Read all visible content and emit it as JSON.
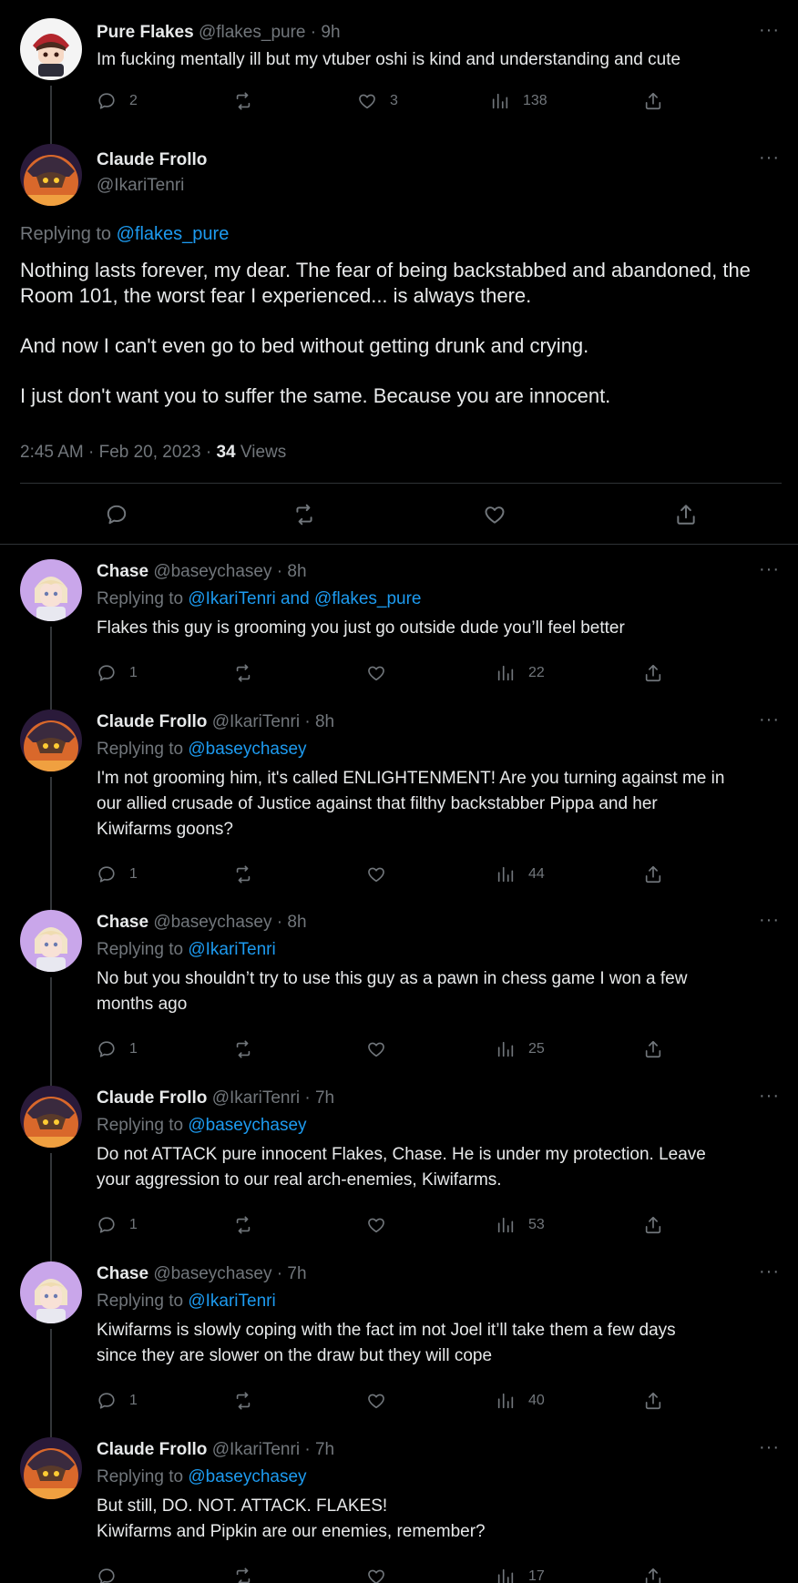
{
  "tweets": [
    {
      "name": "Pure Flakes",
      "handle": "@flakes_pure",
      "time": "9h",
      "text": "Im fucking mentally ill but my vtuber oshi is kind and understanding and cute",
      "replies": "2",
      "retweets": "",
      "likes": "3",
      "views": "138"
    }
  ],
  "focused": {
    "name": "Claude Frollo",
    "handle": "@IkariTenri",
    "replying_prefix": "Replying to ",
    "replying_to": "@flakes_pure",
    "paragraphs": [
      "Nothing lasts forever, my dear. The fear of being backstabbed and abandoned, the Room 101, the worst fear I experienced... is always there.",
      "And now I can't even go to bed without getting drunk and crying.",
      "I just don't want you to suffer the same. Because you are innocent."
    ],
    "timestamp": "2:45 AM · Feb 20, 2023 · ",
    "views_count": "34",
    "views_label": " Views"
  },
  "replies": [
    {
      "name": "Chase",
      "handle": "@baseychasey",
      "time": "8h",
      "replying_prefix": "Replying to ",
      "replying_to": "@IkariTenri and @flakes_pure",
      "lines": [
        "Flakes this guy is grooming you just go outside dude you’ll feel better"
      ],
      "replies": "1",
      "views": "22"
    },
    {
      "name": "Claude Frollo",
      "handle": "@IkariTenri",
      "time": "8h",
      "replying_prefix": "Replying to ",
      "replying_to": "@baseychasey",
      "lines": [
        "I'm not grooming him, it's called ENLIGHTENMENT! Are you turning against me in",
        "our allied crusade of Justice against that filthy backstabber Pippa and her",
        "Kiwifarms goons?"
      ],
      "replies": "1",
      "views": "44"
    },
    {
      "name": "Chase",
      "handle": "@baseychasey",
      "time": "8h",
      "replying_prefix": "Replying to ",
      "replying_to": "@IkariTenri",
      "lines": [
        "No but you shouldn’t try to use this guy as a pawn in chess game I won a few",
        "months ago"
      ],
      "replies": "1",
      "views": "25"
    },
    {
      "name": "Claude Frollo",
      "handle": "@IkariTenri",
      "time": "7h",
      "replying_prefix": "Replying to ",
      "replying_to": "@baseychasey",
      "lines": [
        "Do not ATTACK pure innocent Flakes, Chase. He is under my protection. Leave",
        "your aggression to our real arch-enemies, Kiwifarms."
      ],
      "replies": "1",
      "views": "53"
    },
    {
      "name": "Chase",
      "handle": "@baseychasey",
      "time": "7h",
      "replying_prefix": "Replying to ",
      "replying_to": "@IkariTenri",
      "lines": [
        "Kiwifarms is slowly coping with the fact im not Joel it’ll take them a few days",
        "since they are slower on the draw but they will cope"
      ],
      "replies": "1",
      "views": "40"
    },
    {
      "name": "Claude Frollo",
      "handle": "@IkariTenri",
      "time": "7h",
      "replying_prefix": "Replying to ",
      "replying_to": "@baseychasey",
      "lines": [
        "But still, DO. NOT. ATTACK. FLAKES!",
        "Kiwifarms and Pipkin are our enemies, remember?"
      ],
      "replies": "",
      "views": "17"
    }
  ],
  "separator": " · ",
  "more_glyph": "···",
  "icons": [
    "reply-icon",
    "retweet-icon",
    "like-icon",
    "views-icon",
    "share-icon",
    "more-icon"
  ],
  "colors": {
    "background": "#000000",
    "text": "#e7e9ea",
    "muted": "#71767b",
    "link": "#1d9bf0",
    "line": "#333639"
  }
}
